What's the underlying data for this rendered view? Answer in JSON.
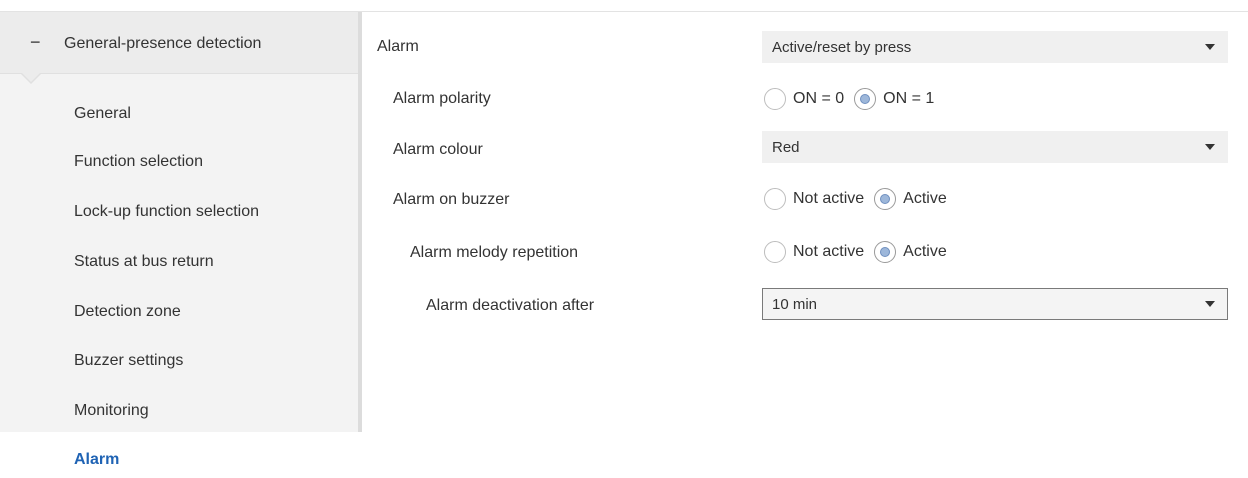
{
  "sidebar": {
    "group": {
      "toggle": "−",
      "label": "General-presence detection"
    },
    "items": [
      {
        "label": "General"
      },
      {
        "label": "Function selection"
      },
      {
        "label": "Lock-up function selection"
      },
      {
        "label": "Status at bus return"
      },
      {
        "label": "Detection zone"
      },
      {
        "label": "Buzzer settings"
      },
      {
        "label": "Monitoring"
      },
      {
        "label": "Alarm"
      }
    ],
    "active_item": "Alarm"
  },
  "main": {
    "alarm": {
      "label": "Alarm",
      "value": "Active/reset by press"
    },
    "alarm_polarity": {
      "label": "Alarm polarity",
      "options": [
        "ON = 0",
        "ON = 1"
      ],
      "selected": "ON = 1"
    },
    "alarm_colour": {
      "label": "Alarm colour",
      "value": "Red"
    },
    "alarm_on_buzzer": {
      "label": "Alarm on buzzer",
      "options": [
        "Not active",
        "Active"
      ],
      "selected": "Active"
    },
    "alarm_melody_repetition": {
      "label": "Alarm melody repetition",
      "options": [
        "Not active",
        "Active"
      ],
      "selected": "Active"
    },
    "alarm_deactivation_after": {
      "label": "Alarm deactivation after",
      "value": "10 min"
    }
  },
  "colors": {
    "active_nav": "#1f63b4",
    "radio_dot": "#9db7da",
    "sidebar_bg": "#f3f3f3"
  }
}
